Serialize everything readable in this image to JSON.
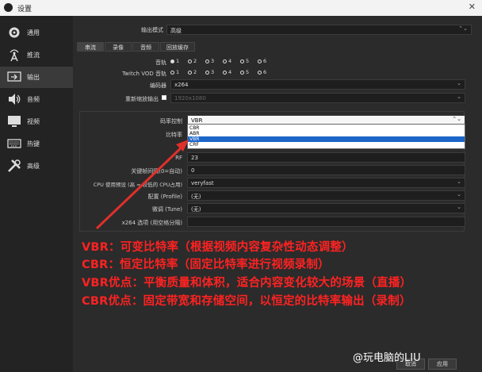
{
  "window": {
    "title": "设置"
  },
  "sidebar": {
    "items": [
      {
        "label": "通用",
        "icon": "gear-icon"
      },
      {
        "label": "推流",
        "icon": "broadcast-icon"
      },
      {
        "label": "输出",
        "icon": "output-icon"
      },
      {
        "label": "音频",
        "icon": "speaker-icon"
      },
      {
        "label": "视频",
        "icon": "monitor-icon"
      },
      {
        "label": "热键",
        "icon": "keyboard-icon"
      },
      {
        "label": "高级",
        "icon": "wrench-icon"
      }
    ],
    "active": "输出"
  },
  "output_mode": {
    "label": "输出模式",
    "value": "高级"
  },
  "tabs": [
    "串流",
    "录像",
    "音频",
    "回放缓存"
  ],
  "audio_track": {
    "label": "音轨",
    "options": [
      "1",
      "2",
      "3",
      "4",
      "5",
      "6"
    ],
    "selected": "1"
  },
  "twitch_vod": {
    "label": "Twitch VOD 音轨",
    "options": [
      "1",
      "2",
      "3",
      "4",
      "5",
      "6"
    ]
  },
  "encoder": {
    "label": "编码器",
    "value": "x264"
  },
  "rescale": {
    "label": "重新缩放输出",
    "value": "1920x1080"
  },
  "rate_control": {
    "label": "码率控制",
    "value": "VBR",
    "options": [
      "CBR",
      "ABR",
      "VBR",
      "CRF"
    ],
    "highlighted": "VBR"
  },
  "bitrate": {
    "label": "比特率"
  },
  "crf": {
    "label": "RF",
    "value": "23"
  },
  "keyframe": {
    "label": "关键帧间隔(0=自动)",
    "value": "0"
  },
  "cpu_preset": {
    "label": "CPU 使用预设 (高 = 较低的 CPU占用)",
    "value": "veryfast"
  },
  "profile": {
    "label": "配置 (Profile)",
    "value": "(无)"
  },
  "tune": {
    "label": "微调 (Tune)",
    "value": "(无)"
  },
  "x264_opts": {
    "label": "x264 选项 (用空格分隔)",
    "value": ""
  },
  "annotations": [
    "VBR：可变比特率（根据视频内容复杂性动态调整）",
    "CBR：恒定比特率（固定比特率进行视频录制）",
    "VBR优点：平衡质量和体积，适合内容变化较大的场景（直播）",
    "CBR优点：固定带宽和存储空间，以恒定的比特率输出（录制）"
  ],
  "annotation_color": "#ff2222",
  "watermark": "@玩电脑的LIU",
  "footer": {
    "cancel": "取消",
    "apply": "应用"
  }
}
